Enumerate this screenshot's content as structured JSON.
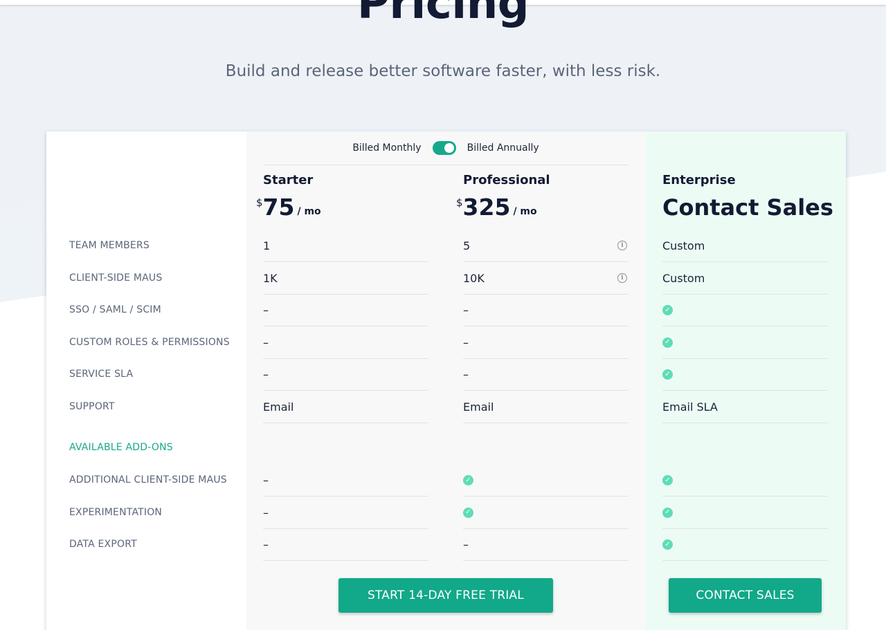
{
  "hero": {
    "title": "Pricing",
    "subtitle": "Build and release better software faster, with less risk."
  },
  "billing": {
    "monthly_label": "Billed Monthly",
    "annually_label": "Billed Annually"
  },
  "plans": [
    {
      "name": "Starter",
      "currency": "$",
      "amount": "75",
      "period": "/ mo"
    },
    {
      "name": "Professional",
      "currency": "$",
      "amount": "325",
      "period": "/ mo"
    },
    {
      "name": "Enterprise",
      "price_text": "Contact Sales"
    }
  ],
  "rows": [
    {
      "label": "TEAM MEMBERS",
      "values": [
        "1",
        "5",
        "Custom"
      ]
    },
    {
      "label": "CLIENT-SIDE MAUS",
      "values": [
        "1K",
        "10K",
        "Custom"
      ]
    },
    {
      "label": "SSO / SAML / SCIM",
      "values": [
        "–",
        "–",
        "check"
      ]
    },
    {
      "label": "CUSTOM ROLES & PERMISSIONS",
      "values": [
        "–",
        "–",
        "check"
      ]
    },
    {
      "label": "SERVICE SLA",
      "values": [
        "–",
        "–",
        "check"
      ]
    },
    {
      "label": "SUPPORT",
      "values": [
        "Email",
        "Email",
        "Email SLA"
      ]
    }
  ],
  "addons_label": "AVAILABLE ADD-ONS",
  "addon_rows": [
    {
      "label": "ADDITIONAL CLIENT-SIDE MAUS",
      "values": [
        "–",
        "check",
        "check"
      ]
    },
    {
      "label": "EXPERIMENTATION",
      "values": [
        "–",
        "check",
        "check"
      ]
    },
    {
      "label": "DATA EXPORT",
      "values": [
        "–",
        "–",
        "check"
      ]
    }
  ],
  "buttons": {
    "trial": "START 14-DAY FREE TRIAL",
    "contact": "CONTACT SALES"
  },
  "colors": {
    "accent": "#12a88a",
    "check": "#5fdcb7",
    "enterprise_bg": "#edfbf5"
  }
}
